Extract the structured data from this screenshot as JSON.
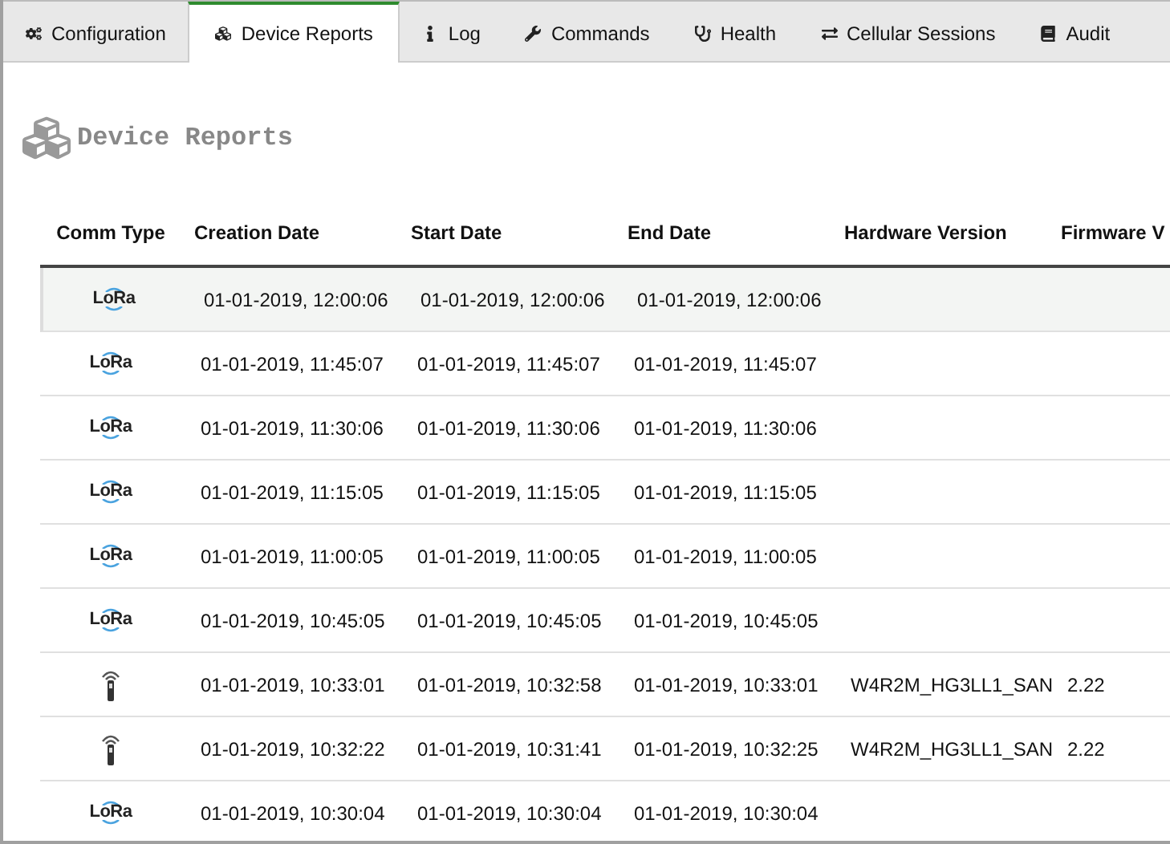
{
  "tabs": [
    {
      "label": "Configuration",
      "selected": false
    },
    {
      "label": "Device Reports",
      "selected": true
    },
    {
      "label": "Log",
      "selected": false
    },
    {
      "label": "Commands",
      "selected": false
    },
    {
      "label": "Health",
      "selected": false
    },
    {
      "label": "Cellular Sessions",
      "selected": false
    },
    {
      "label": "Audit",
      "selected": false
    }
  ],
  "page_title": "Device Reports",
  "table": {
    "columns": [
      "Comm Type",
      "Creation Date",
      "Start Date",
      "End Date",
      "Hardware Version",
      "Firmware V"
    ],
    "rows": [
      {
        "selected": true,
        "cells": [
          {
            "kind": "lora",
            "text": "LoRa"
          },
          "01-01-2019, 12:00:06",
          "01-01-2019, 12:00:06",
          "01-01-2019, 12:00:06"
        ]
      },
      {
        "selected": false,
        "cells": [
          {
            "kind": "lora",
            "text": "LoRa"
          },
          "01-01-2019, 11:45:07",
          "01-01-2019, 11:45:07",
          "01-01-2019, 11:45:07"
        ]
      },
      {
        "selected": false,
        "cells": [
          {
            "kind": "lora",
            "text": "LoRa"
          },
          "01-01-2019, 11:30:06",
          "01-01-2019, 11:30:06",
          "01-01-2019, 11:30:06"
        ]
      },
      {
        "selected": false,
        "cells": [
          {
            "kind": "lora",
            "text": "LoRa"
          },
          "01-01-2019, 11:15:05",
          "01-01-2019, 11:15:05",
          "01-01-2019, 11:15:05"
        ]
      },
      {
        "selected": false,
        "cells": [
          {
            "kind": "lora",
            "text": "LoRa"
          },
          "01-01-2019, 11:00:05",
          "01-01-2019, 11:00:05",
          "01-01-2019, 11:00:05"
        ]
      },
      {
        "selected": false,
        "cells": [
          {
            "kind": "lora",
            "text": "LoRa"
          },
          "01-01-2019, 10:45:05",
          "01-01-2019, 10:45:05",
          "01-01-2019, 10:45:05"
        ]
      },
      {
        "selected": false,
        "cells": [
          {
            "kind": "cellular"
          },
          "01-01-2019, 10:33:01",
          "01-01-2019, 10:32:58",
          "01-01-2019, 10:33:01",
          "W4R2M_HG3LL1_SAN",
          "2.22"
        ]
      },
      {
        "selected": false,
        "cells": [
          {
            "kind": "cellular"
          },
          "01-01-2019, 10:32:22",
          "01-01-2019, 10:31:41",
          "01-01-2019, 10:32:25",
          "W4R2M_HG3LL1_SAN",
          "2.22"
        ]
      },
      {
        "selected": false,
        "cells": [
          {
            "kind": "lora",
            "text": "LoRa"
          },
          "01-01-2019, 10:30:04",
          "01-01-2019, 10:30:04",
          "01-01-2019, 10:30:04"
        ]
      }
    ]
  }
}
